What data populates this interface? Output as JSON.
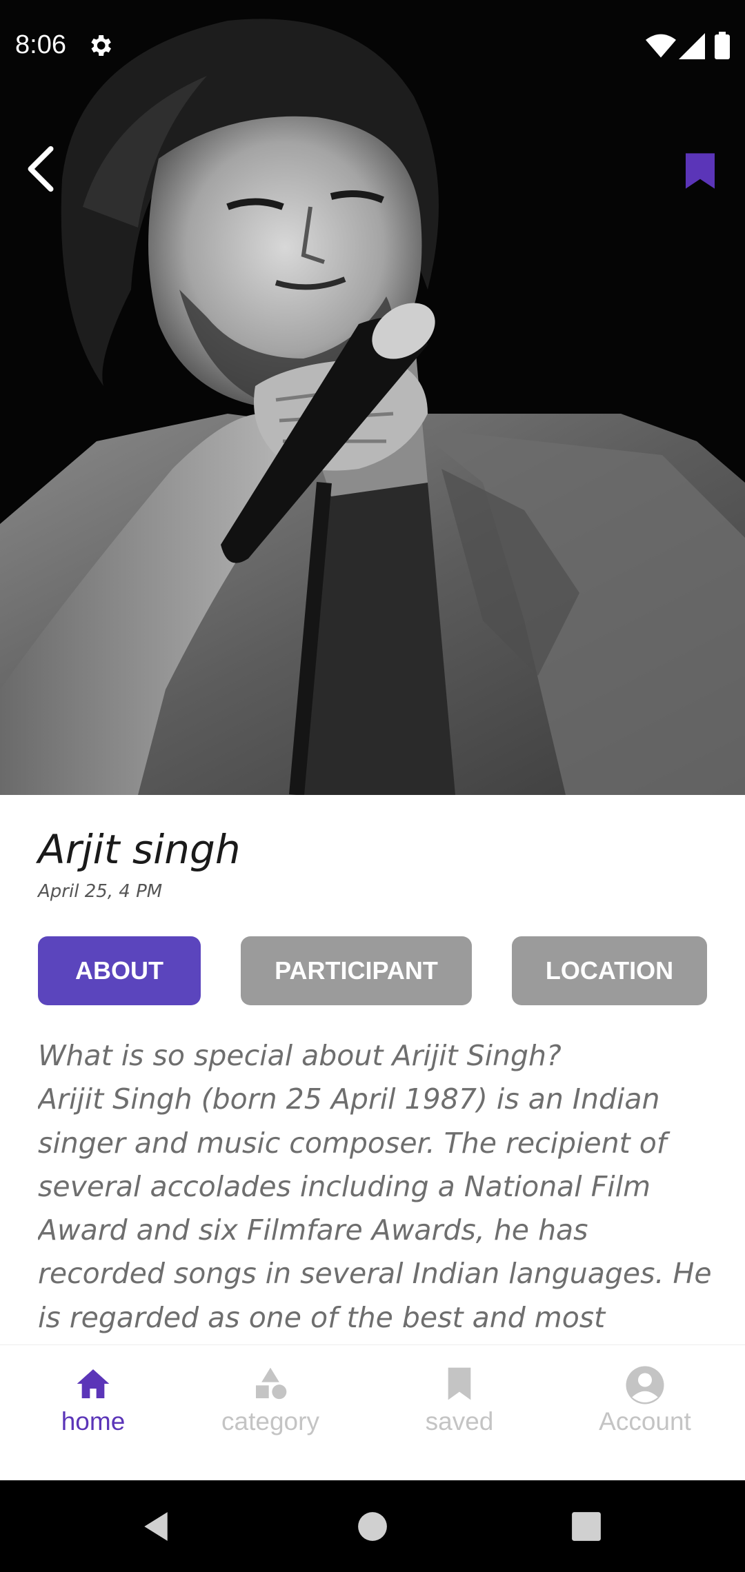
{
  "status_bar": {
    "time": "8:06",
    "icons": [
      "settings-icon",
      "wifi-icon",
      "signal-icon",
      "battery-icon"
    ]
  },
  "header": {
    "back_icon": "chevron-left-icon",
    "bookmark_icon": "bookmark-icon"
  },
  "event": {
    "title": "Arjit singh",
    "date": "April 25, 4 PM"
  },
  "tabs": [
    {
      "label": "ABOUT",
      "active": true
    },
    {
      "label": "PARTICIPANT",
      "active": false
    },
    {
      "label": "LOCATION",
      "active": false
    }
  ],
  "about": {
    "text": "What is so special about Arijit Singh?\nArijit Singh (born 25 April 1987) is an Indian singer and music composer. The recipient of several accolades including a National Film Award and six Filmfare Awards, he has recorded songs in several Indian languages. He is regarded as one of the best and most"
  },
  "bottom_nav": {
    "items": [
      {
        "label": "home",
        "icon": "home-icon",
        "active": true
      },
      {
        "label": "category",
        "icon": "category-icon",
        "active": false
      },
      {
        "label": "saved",
        "icon": "bookmark-icon",
        "active": false
      },
      {
        "label": "Account",
        "icon": "account-icon",
        "active": false
      }
    ]
  },
  "colors": {
    "accent": "#5b45bd",
    "nav_active": "#5b35b8",
    "tab_inactive": "#9b9b9b",
    "nav_inactive": "#c4c4c4"
  }
}
